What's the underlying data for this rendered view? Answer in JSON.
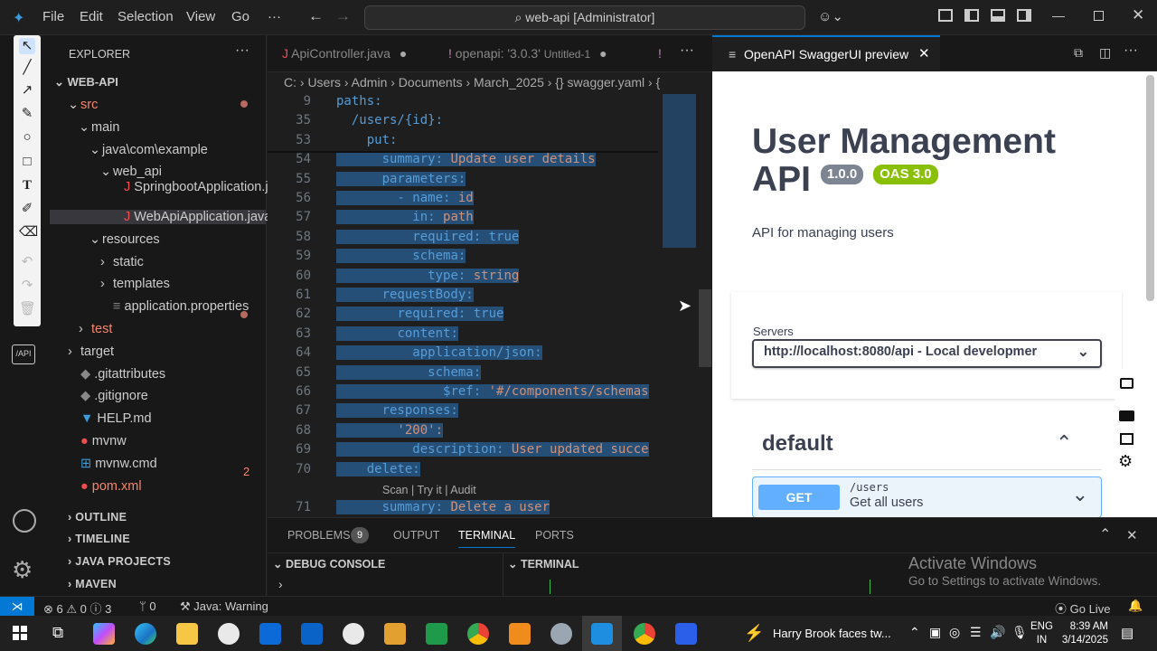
{
  "titlebar": {
    "menus": [
      "File",
      "Edit",
      "Selection",
      "View",
      "Go",
      "···"
    ],
    "command_center": "web-api [Administrator]"
  },
  "explorer": {
    "header": "EXPLORER",
    "root": "WEB-API",
    "items": [
      {
        "label": "src",
        "indent": 1,
        "arrow": "⌄",
        "icon": "",
        "color": "#f48771"
      },
      {
        "label": "main",
        "indent": 2,
        "arrow": "⌄",
        "icon": "",
        "color": "#ccc"
      },
      {
        "label": "java\\com\\example",
        "indent": 3,
        "arrow": "⌄",
        "icon": "",
        "color": "#ccc"
      },
      {
        "label": "web_api",
        "indent": 4,
        "arrow": "⌄",
        "icon": "",
        "color": "#ccc"
      },
      {
        "label": "SpringbootApplication.j...",
        "indent": 5,
        "arrow": "",
        "icon": "J",
        "color": "#ccc"
      },
      {
        "label": "WebApiApplication.java",
        "indent": 5,
        "arrow": "",
        "icon": "J",
        "color": "#ccc"
      },
      {
        "label": "resources",
        "indent": 3,
        "arrow": "⌄",
        "icon": "",
        "color": "#ccc"
      },
      {
        "label": "static",
        "indent": 4,
        "arrow": "›",
        "icon": "",
        "color": "#ccc"
      },
      {
        "label": "templates",
        "indent": 4,
        "arrow": "›",
        "icon": "",
        "color": "#ccc"
      },
      {
        "label": "application.properties",
        "indent": 4,
        "arrow": "",
        "icon": "≡",
        "color": "#ccc"
      },
      {
        "label": "test",
        "indent": 2,
        "arrow": "›",
        "icon": "",
        "color": "#f48771"
      },
      {
        "label": "target",
        "indent": 1,
        "arrow": "›",
        "icon": "",
        "color": "#ccc"
      },
      {
        "label": ".gitattributes",
        "indent": 1,
        "arrow": "",
        "icon": "◆",
        "color": "#ccc"
      },
      {
        "label": ".gitignore",
        "indent": 1,
        "arrow": "",
        "icon": "◆",
        "color": "#ccc"
      },
      {
        "label": "HELP.md",
        "indent": 1,
        "arrow": "",
        "icon": "▼",
        "color": "#ccc"
      },
      {
        "label": "mvnw",
        "indent": 1,
        "arrow": "",
        "icon": "●",
        "color": "#ccc"
      },
      {
        "label": "mvnw.cmd",
        "indent": 1,
        "arrow": "",
        "icon": "⊞",
        "color": "#ccc"
      },
      {
        "label": "pom.xml",
        "indent": 1,
        "arrow": "",
        "icon": "●",
        "color": "#f48771"
      }
    ],
    "pom_badge": "2",
    "sections": [
      "OUTLINE",
      "TIMELINE",
      "JAVA PROJECTS",
      "MAVEN"
    ]
  },
  "editor": {
    "tabs": [
      {
        "label": "ApiController.java",
        "icon": "J"
      },
      {
        "label": "openapi: '3.0.3'",
        "extra": "Untitled-1",
        "icon": "!"
      }
    ],
    "breadcrumb": "C: › Users › Admin › Documents › March_2025 › {} swagger.yaml › {",
    "lens": "Scan | Try it | Audit",
    "lines": [
      {
        "n": "9",
        "t": "paths:",
        "c": "k",
        "ind": 0,
        "sel": false
      },
      {
        "n": "35",
        "t": "/users/{id}:",
        "c": "k",
        "ind": 1,
        "sel": false
      },
      {
        "n": "53",
        "t": "put:",
        "c": "k",
        "ind": 2,
        "sel": false
      },
      {
        "n": "54",
        "t": "summary: ",
        "v": "Update user details",
        "c": "k",
        "vc": "s",
        "ind": 3,
        "sel": true
      },
      {
        "n": "55",
        "t": "parameters:",
        "c": "k",
        "ind": 3,
        "sel": true
      },
      {
        "n": "56",
        "t": "- name: ",
        "v": "id",
        "c": "k",
        "vc": "s",
        "ind": 4,
        "sel": true
      },
      {
        "n": "57",
        "t": "in: ",
        "v": "path",
        "c": "k",
        "vc": "s",
        "ind": 5,
        "sel": true
      },
      {
        "n": "58",
        "t": "required: ",
        "v": "true",
        "c": "k",
        "vc": "k",
        "ind": 5,
        "sel": true
      },
      {
        "n": "59",
        "t": "schema:",
        "c": "k",
        "ind": 5,
        "sel": true
      },
      {
        "n": "60",
        "t": "type: ",
        "v": "string",
        "c": "k",
        "vc": "s",
        "ind": 6,
        "sel": true
      },
      {
        "n": "61",
        "t": "requestBody:",
        "c": "k",
        "ind": 3,
        "sel": true
      },
      {
        "n": "62",
        "t": "required: ",
        "v": "true",
        "c": "k",
        "vc": "k",
        "ind": 4,
        "sel": true
      },
      {
        "n": "63",
        "t": "content:",
        "c": "k",
        "ind": 4,
        "sel": true
      },
      {
        "n": "64",
        "t": "application/json:",
        "c": "k",
        "ind": 5,
        "sel": true
      },
      {
        "n": "65",
        "t": "schema:",
        "c": "k",
        "ind": 6,
        "sel": true
      },
      {
        "n": "66",
        "t": "$ref: ",
        "v": "'#/components/schemas",
        "c": "k",
        "vc": "s",
        "ind": 7,
        "sel": true
      },
      {
        "n": "67",
        "t": "responses:",
        "c": "k",
        "ind": 3,
        "sel": true
      },
      {
        "n": "68",
        "t": "'200':",
        "c": "s",
        "ind": 4,
        "sel": true
      },
      {
        "n": "69",
        "t": "description: ",
        "v": "User updated succe",
        "c": "k",
        "vc": "s",
        "ind": 5,
        "sel": true
      },
      {
        "n": "70",
        "t": "delete:",
        "c": "k",
        "ind": 2,
        "sel": true
      },
      {
        "n": "71",
        "t": "summary: ",
        "v": "Delete a user",
        "c": "k",
        "vc": "s",
        "ind": 3,
        "sel": true
      }
    ]
  },
  "preview": {
    "tab_label": "OpenAPI SwaggerUI preview",
    "title_line1": "User Management",
    "title_line2": "API",
    "version": "1.0.0",
    "oas": "OAS 3.0",
    "description": "API for managing users",
    "servers_label": "Servers",
    "server_value": "http://localhost:8080/api - Local developmer",
    "section": "default",
    "op_method": "GET",
    "op_path": "/users",
    "op_summary": "Get all users",
    "colors": {
      "get": "#61affe",
      "get_bg": "#ebf3fb",
      "version": "#7d8492",
      "oas": "#89bf04"
    }
  },
  "panel": {
    "tabs": [
      "PROBLEMS",
      "OUTPUT",
      "TERMINAL",
      "PORTS"
    ],
    "problems_count": "9",
    "debug": "DEBUG CONSOLE",
    "terminal": "TERMINAL",
    "watermark1": "Activate Windows",
    "watermark2": "Go to Settings to activate Windows."
  },
  "status": {
    "errors": "6",
    "warnings": "0",
    "info": "3",
    "ports": "0",
    "java": "Java: Warning",
    "golive": "Go Live"
  },
  "taskbar": {
    "news": "Harry Brook faces tw...",
    "lang1": "ENG",
    "lang2": "IN",
    "time": "8:39 AM",
    "date": "3/14/2025"
  }
}
